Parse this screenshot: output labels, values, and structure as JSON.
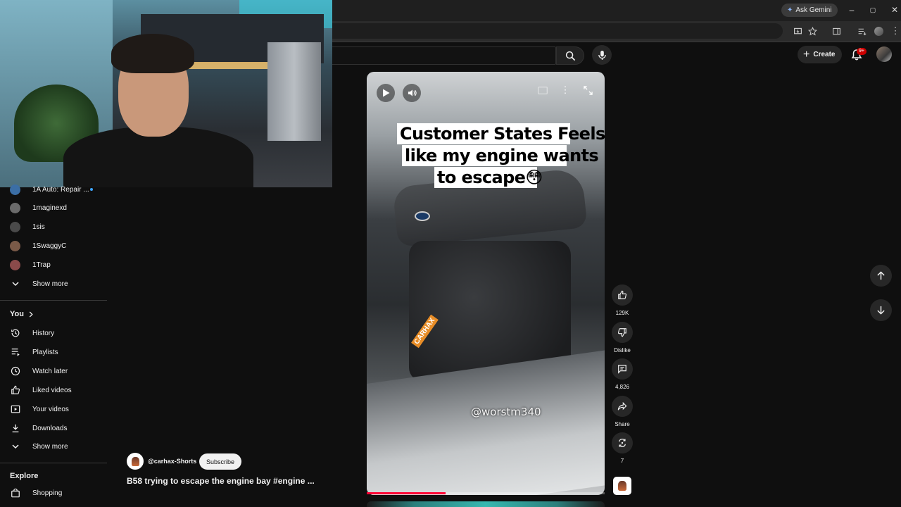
{
  "browser": {
    "gemini_label": "Ask Gemini",
    "window_controls": [
      "–",
      "▢",
      "✕"
    ]
  },
  "header": {
    "create_label": "Create",
    "notifications_badge": "9+"
  },
  "sidebar": {
    "subscriptions": [
      {
        "label": "1A Auto: Repair ...",
        "avatar_color": "#3b6ea5",
        "live": true
      },
      {
        "label": "1maginexd",
        "avatar_color": "#6b6b6b",
        "live": false
      },
      {
        "label": "1sis",
        "avatar_color": "#4a4a4a",
        "live": false
      },
      {
        "label": "1SwaggyC",
        "avatar_color": "#7a5a48",
        "live": false
      },
      {
        "label": "1Trap",
        "avatar_color": "#8a4a4a",
        "live": false
      }
    ],
    "subs_show_more": "Show more",
    "you_heading": "You",
    "you_items": [
      {
        "label": "History",
        "icon": "history-icon"
      },
      {
        "label": "Playlists",
        "icon": "playlists-icon"
      },
      {
        "label": "Watch later",
        "icon": "clock-icon"
      },
      {
        "label": "Liked videos",
        "icon": "thumbs-up-icon"
      },
      {
        "label": "Your videos",
        "icon": "video-icon"
      },
      {
        "label": "Downloads",
        "icon": "download-icon"
      }
    ],
    "you_show_more": "Show more",
    "explore_heading": "Explore",
    "explore_items": [
      {
        "label": "Shopping",
        "icon": "shopping-bag-icon"
      }
    ]
  },
  "short": {
    "caption_lines": [
      "Customer States Feels",
      "like my engine wants",
      "to escape😳"
    ],
    "watermark": "@worstm340",
    "sticker": "CARHAX",
    "progress_fraction": 0.33,
    "channel": "@carhax-Shorts",
    "subscribe_label": "Subscribe",
    "title": "B58 trying to escape the engine bay #engine ..."
  },
  "actions": {
    "likes": "129K",
    "dislike_label": "Dislike",
    "comments": "4,826",
    "share_label": "Share",
    "remix_count": "7"
  }
}
